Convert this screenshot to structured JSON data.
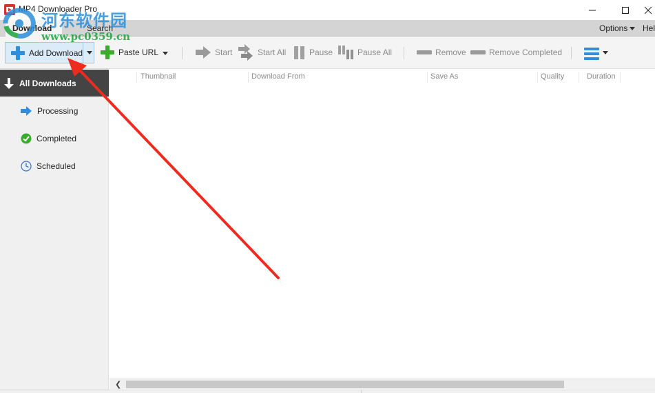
{
  "window": {
    "title": "MP4 Downloader Pro"
  },
  "watermark": {
    "site_name": "河东软件园",
    "url": "www.pc0359.cn"
  },
  "tabs": {
    "download": "Download",
    "search": "Search",
    "options": "Options",
    "help": "Help"
  },
  "toolbar": {
    "add_download": "Add Download",
    "paste_url": "Paste URL",
    "start": "Start",
    "start_all": "Start All",
    "pause": "Pause",
    "pause_all": "Pause All",
    "remove": "Remove",
    "remove_completed": "Remove Completed"
  },
  "sidebar": {
    "all_downloads": "All Downloads",
    "items": [
      {
        "label": "Processing",
        "icon": "arrow-right-icon"
      },
      {
        "label": "Completed",
        "icon": "check-circle-icon"
      },
      {
        "label": "Scheduled",
        "icon": "clock-icon"
      }
    ]
  },
  "table": {
    "columns": [
      "Thumbnail",
      "Download From",
      "Save As",
      "Quality",
      "Duration"
    ]
  },
  "colors": {
    "accent_blue": "#2f8fdc",
    "add_green": "#3aab2b",
    "sidebar_active": "#444444",
    "annotation_red": "#ee2b1f"
  }
}
